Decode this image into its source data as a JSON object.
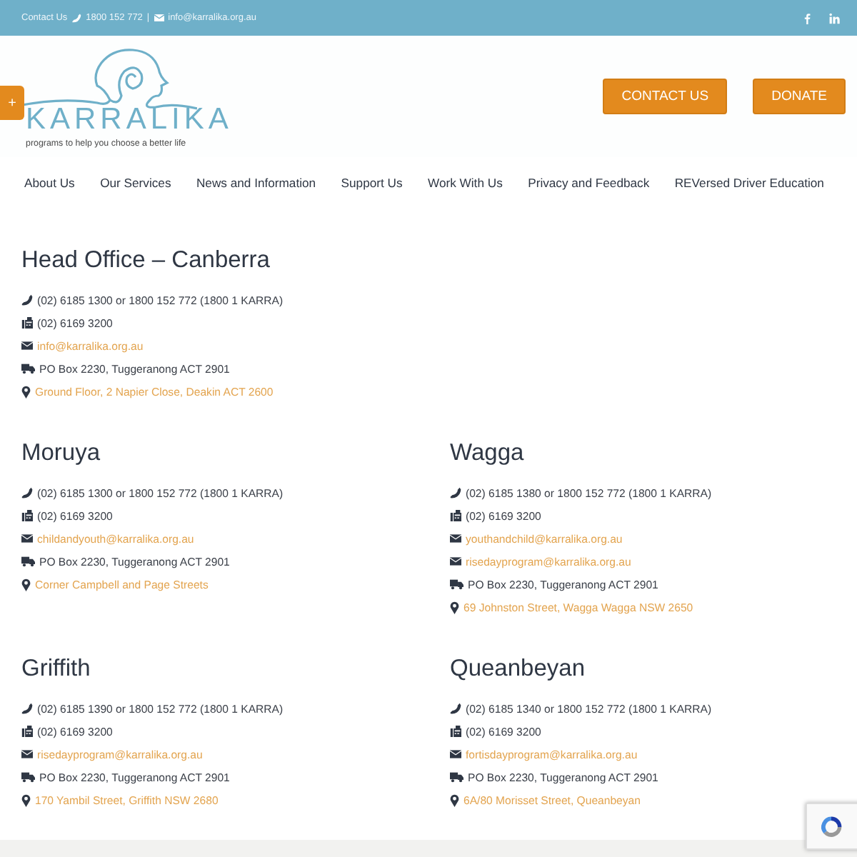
{
  "top_bar": {
    "contact_label": "Contact Us",
    "phone": "1800 152 772",
    "separator": "|",
    "email": "info@karralika.org.au"
  },
  "side_tab": {
    "label": "+"
  },
  "logo": {
    "name": "KARRALIKA",
    "tagline": "programs to help you choose a better life"
  },
  "header_buttons": [
    "CONTACT US",
    "DONATE"
  ],
  "nav": [
    "About Us",
    "Our Services",
    "News and Information",
    "Support Us",
    "Work With Us",
    "Privacy and Feedback",
    "REVersed Driver Education"
  ],
  "offices": [
    {
      "title": "Head Office – Canberra",
      "rows": [
        {
          "kind": "phone",
          "text": "(02) 6185 1300 or 1800 152 772 (1800 1 KARRA)"
        },
        {
          "kind": "fax",
          "text": "(02) 6169 3200"
        },
        {
          "kind": "email",
          "text": "info@karralika.org.au"
        },
        {
          "kind": "post",
          "text": "PO Box 2230, Tuggeranong ACT 2901"
        },
        {
          "kind": "address",
          "text": "Ground Floor, 2 Napier Close, Deakin ACT 2600"
        }
      ]
    },
    {
      "title": "Moruya",
      "rows": [
        {
          "kind": "phone",
          "text": "(02) 6185 1300 or 1800 152 772 (1800 1 KARRA)"
        },
        {
          "kind": "fax",
          "text": "(02) 6169 3200"
        },
        {
          "kind": "email",
          "text": "childandyouth@karralika.org.au"
        },
        {
          "kind": "post",
          "text": "PO Box 2230, Tuggeranong ACT 2901"
        },
        {
          "kind": "address",
          "text": "Corner Campbell and Page Streets"
        }
      ]
    },
    {
      "title": "Wagga",
      "rows": [
        {
          "kind": "phone",
          "text": "(02) 6185 1380 or 1800 152 772 (1800 1 KARRA)"
        },
        {
          "kind": "fax",
          "text": "(02) 6169 3200"
        },
        {
          "kind": "email",
          "text": "youthandchild@karralika.org.au"
        },
        {
          "kind": "email",
          "text": "risedayprogram@karralika.org.au"
        },
        {
          "kind": "post",
          "text": "PO Box 2230, Tuggeranong ACT 2901"
        },
        {
          "kind": "address",
          "text": "69 Johnston Street, Wagga Wagga NSW 2650"
        }
      ]
    },
    {
      "title": "Griffith",
      "rows": [
        {
          "kind": "phone",
          "text": "(02) 6185 1390 or 1800 152 772 (1800 1 KARRA)"
        },
        {
          "kind": "fax",
          "text": "(02) 6169 3200"
        },
        {
          "kind": "email",
          "text": "risedayprogram@karralika.org.au"
        },
        {
          "kind": "post",
          "text": "PO Box 2230, Tuggeranong ACT 2901"
        },
        {
          "kind": "address",
          "text": "170 Yambil Street, Griffith NSW 2680"
        }
      ]
    },
    {
      "title": "Queanbeyan",
      "rows": [
        {
          "kind": "phone",
          "text": "(02) 6185 1340 or 1800 152 772 (1800 1 KARRA)"
        },
        {
          "kind": "fax",
          "text": "(02) 6169 3200"
        },
        {
          "kind": "email",
          "text": "fortisdayprogram@karralika.org.au"
        },
        {
          "kind": "post",
          "text": "PO Box 2230, Tuggeranong ACT 2901"
        },
        {
          "kind": "address",
          "text": "6A/80 Morisset Street, Queanbeyan"
        }
      ]
    }
  ]
}
